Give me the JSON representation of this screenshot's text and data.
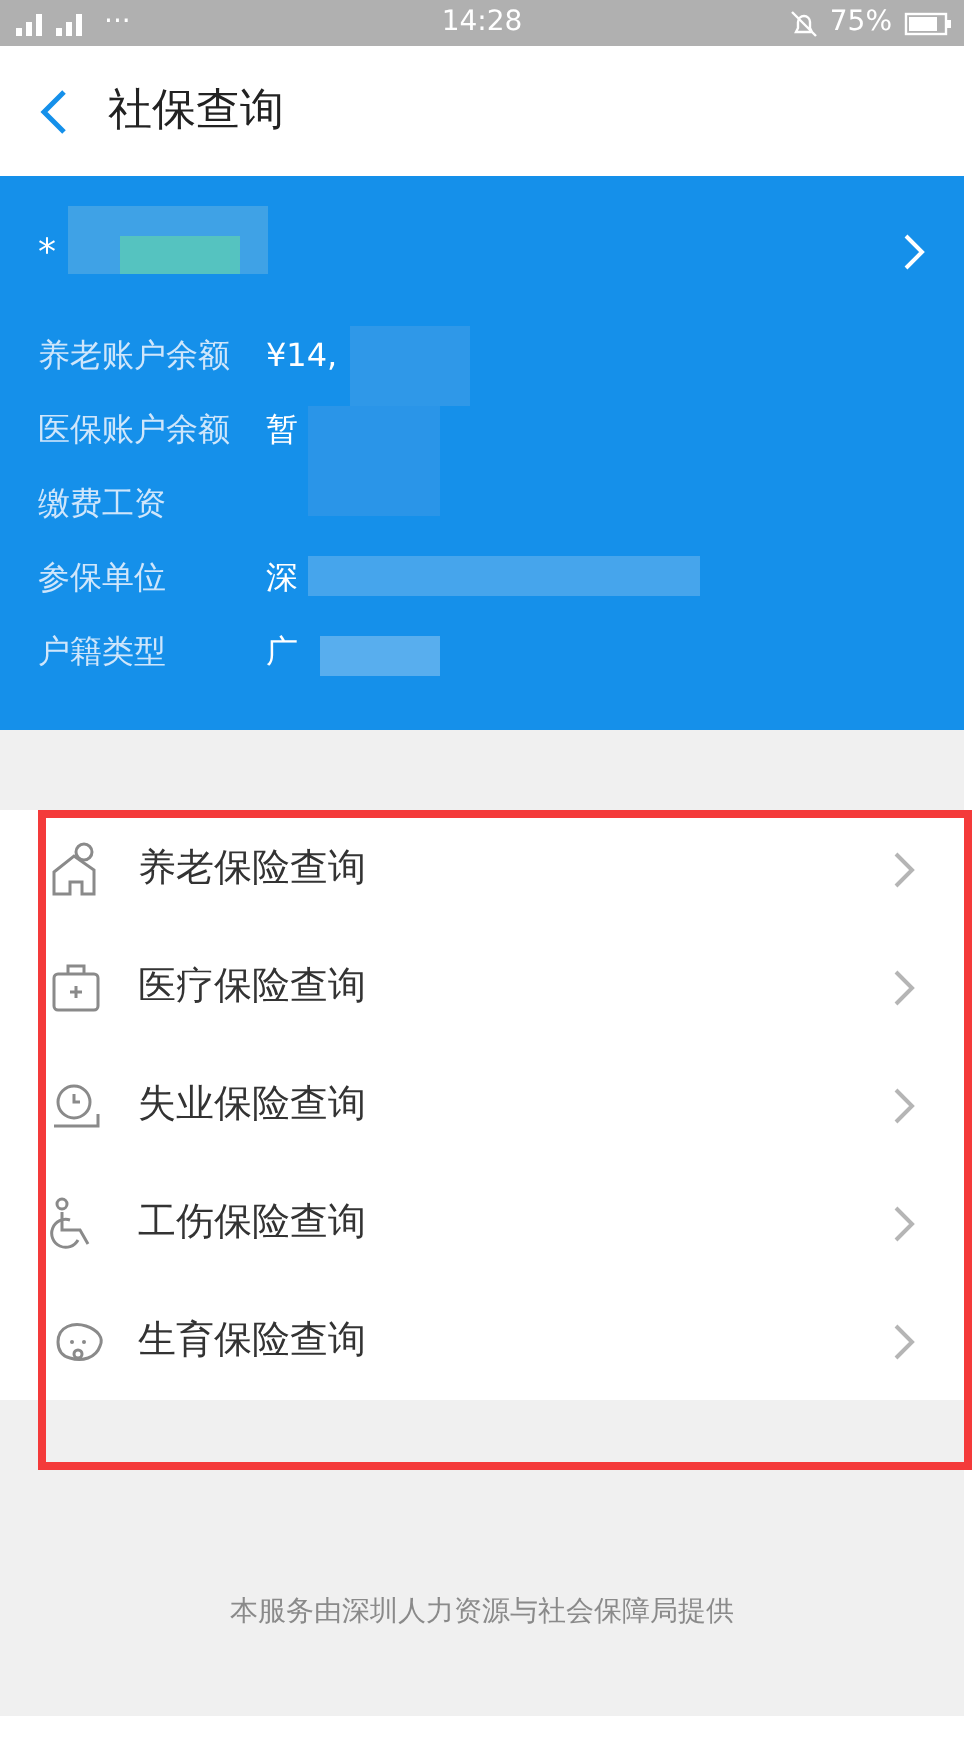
{
  "status_bar": {
    "dots": "···",
    "time": "14:28",
    "battery": "75%"
  },
  "header": {
    "title": "社保查询"
  },
  "account": {
    "name": "*",
    "fields": [
      {
        "label": "养老账户余额",
        "value": "¥14,"
      },
      {
        "label": "医保账户余额",
        "value": "暂"
      },
      {
        "label": "缴费工资"
      },
      {
        "label": "参保单位",
        "value": "深"
      },
      {
        "label": "户籍类型",
        "value": "广"
      }
    ]
  },
  "menu": [
    {
      "kind": "elderly",
      "label": "养老保险查询"
    },
    {
      "kind": "medical",
      "label": "医疗保险查询"
    },
    {
      "kind": "unemployment",
      "label": "失业保险查询"
    },
    {
      "kind": "injury",
      "label": "工伤保险查询"
    },
    {
      "kind": "maternity",
      "label": "生育保险查询"
    }
  ],
  "footer": "本服务由深圳人力资源与社会保障局提供"
}
